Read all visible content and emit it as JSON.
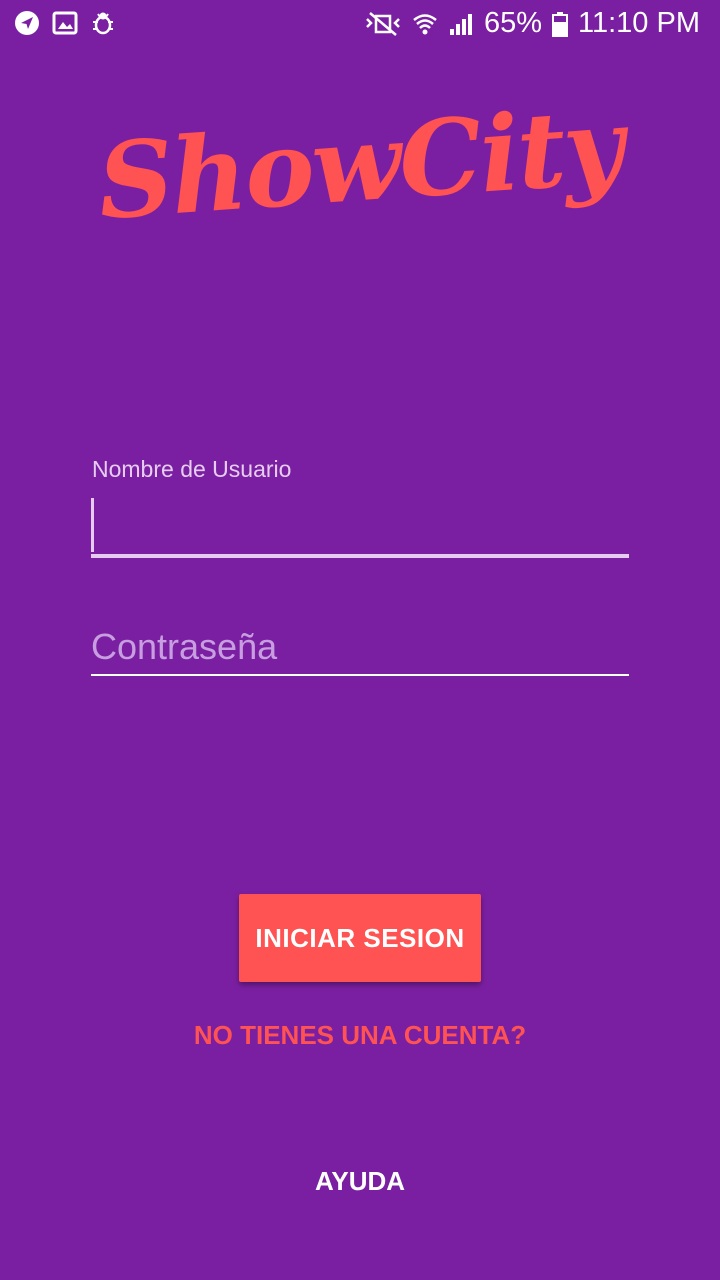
{
  "status_bar": {
    "left_icons": [
      "navigation-icon",
      "image-icon",
      "bug-icon"
    ],
    "right_icons": [
      "mute-vibrate-icon",
      "wifi-icon",
      "signal-icon",
      "battery-icon"
    ],
    "battery": "65%",
    "time": "11:10 PM"
  },
  "app": {
    "logo_text": "ShowCity",
    "brand_color": "#ff5252",
    "background_color": "#7b1fa2"
  },
  "form": {
    "username_label": "Nombre de Usuario",
    "username_value": "",
    "password_placeholder": "Contraseña",
    "password_value": ""
  },
  "actions": {
    "login_label": "INICIAR SESION",
    "signup_link": "NO TIENES UNA CUENTA?",
    "help_link": "AYUDA"
  }
}
